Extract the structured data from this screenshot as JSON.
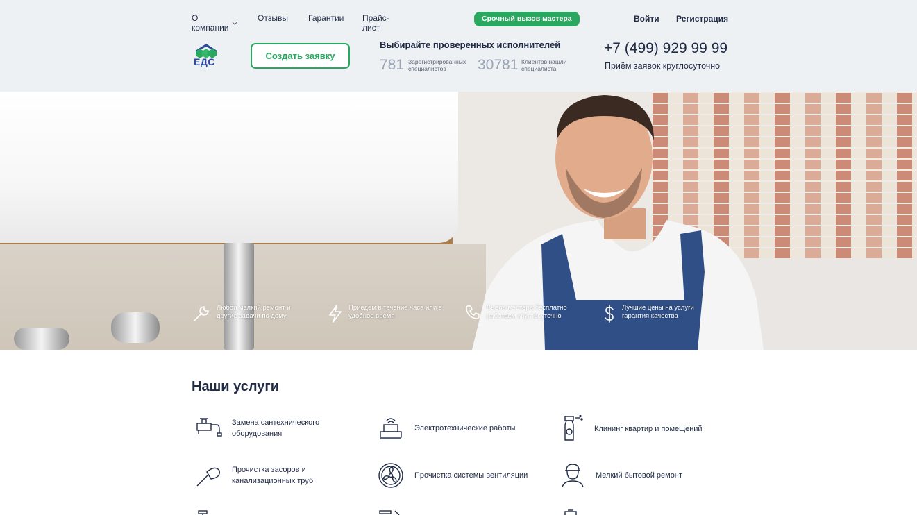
{
  "nav": {
    "company": "О компании",
    "reviews": "Отзывы",
    "guarantees": "Гарантии",
    "pricelist": "Прайс-лист"
  },
  "urgent_call": "Срочный вызов мастера",
  "auth": {
    "login": "Войти",
    "register": "Регистрация"
  },
  "logo_text": "ЕДС",
  "create_request": "Создать заявку",
  "choose": {
    "title": "Выбирайте проверенных исполнителей",
    "stats": [
      {
        "value": "781",
        "label_line1": "Зарегистрированных",
        "label_line2": "специалистов"
      },
      {
        "value": "30781",
        "label_line1": "Клиентов нашли",
        "label_line2": "специалиста"
      }
    ]
  },
  "contact": {
    "phone": "+7 (499) 929 99 99",
    "note": "Приём заявок круглосуточно"
  },
  "features": [
    {
      "icon": "wrench-icon",
      "line1": "Любой мелкий ремонт и",
      "line2": "другие задачи по дому"
    },
    {
      "icon": "lightning-icon",
      "line1": "Приедем в течение часа или в",
      "line2": "удобное время"
    },
    {
      "icon": "phone-icon",
      "line1": "Вызов мастера бесплатно",
      "line2": "работаем круглосуточно"
    },
    {
      "icon": "dollar-icon",
      "line1": "Лучшие цены на услуги",
      "line2": "гарантия качества"
    }
  ],
  "services": {
    "title": "Наши услуги",
    "items": [
      {
        "icon": "faucet-icon",
        "line1": "Замена сантехнического",
        "line2": "оборудования"
      },
      {
        "icon": "electric-icon",
        "line1": "Электротехнические работы",
        "line2": ""
      },
      {
        "icon": "spray-icon",
        "line1": "Клининг квартир и помещений",
        "line2": ""
      },
      {
        "icon": "plunger-icon",
        "line1": "Прочистка засоров и",
        "line2": "канализационных труб"
      },
      {
        "icon": "fan-icon",
        "line1": "Прочистка системы вентиляции",
        "line2": ""
      },
      {
        "icon": "worker-icon",
        "line1": "Мелкий бытовой ремонт",
        "line2": ""
      }
    ]
  },
  "colors": {
    "accent": "#2aa860",
    "text": "#1f2a44",
    "header_bg": "#eef1f4",
    "logo_blue": "#2b4aa0"
  }
}
